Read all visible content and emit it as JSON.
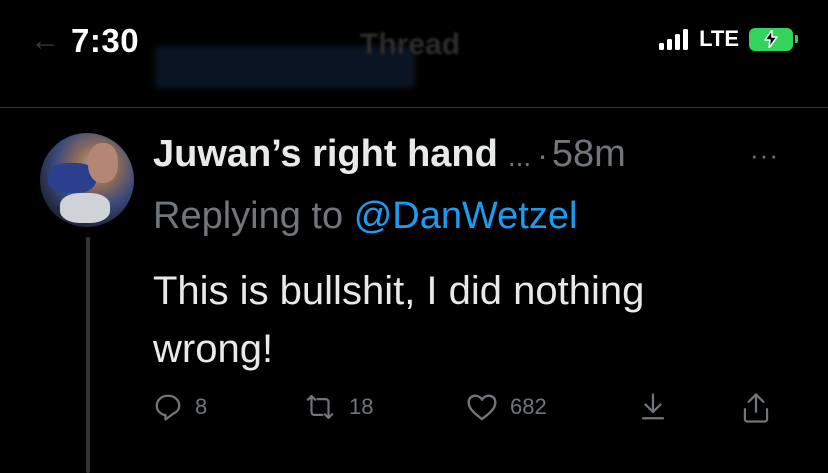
{
  "status_bar": {
    "time": "7:30",
    "network": "LTE",
    "battery_color": "#33d45c"
  },
  "header": {
    "title": "Thread"
  },
  "tweet": {
    "display_name": "Juwan’s right hand",
    "ellipsis": "...",
    "separator": "·",
    "time_ago": "58m",
    "more": "···",
    "replying_label": "Replying to",
    "replying_to": "@DanWetzel",
    "text": "This is bullshit, I did nothing wrong!",
    "actions": {
      "replies": "8",
      "retweets": "18",
      "likes": "682"
    }
  },
  "colors": {
    "background": "#000000",
    "text": "#e7e9ea",
    "muted": "#71767b",
    "accent": "#1d9bf0"
  },
  "icons": [
    "back-arrow-icon",
    "signal-icon",
    "battery-charging-icon",
    "avatar",
    "more-icon",
    "reply-icon",
    "retweet-icon",
    "like-icon",
    "bookmark-icon",
    "share-icon"
  ]
}
